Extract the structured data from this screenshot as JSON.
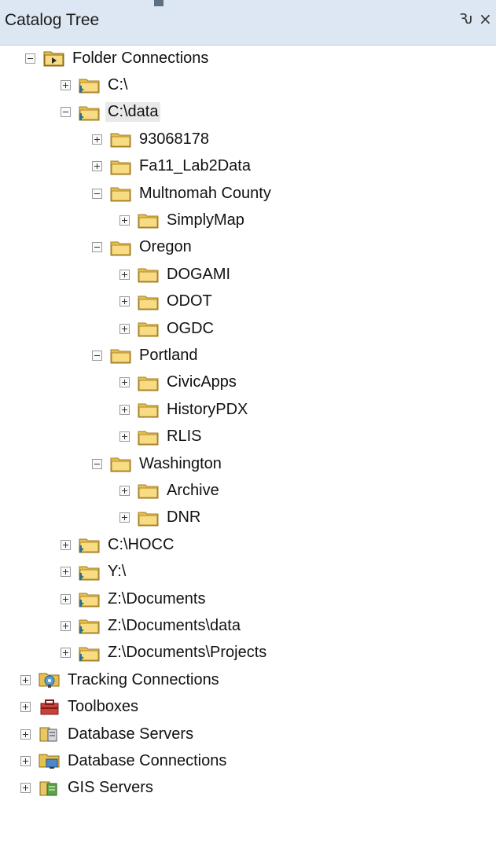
{
  "panel": {
    "title": "Catalog Tree",
    "pin_glyph": "Ԅ",
    "close_glyph": "×"
  },
  "tree": [
    {
      "label": "Folder Connections",
      "expanded": true,
      "icon": "folder-connections-icon"
    },
    {
      "label": "C:\\",
      "expanded": false,
      "icon": "folder-connection-icon"
    },
    {
      "label": "C:\\data",
      "expanded": true,
      "icon": "folder-connection-icon",
      "selected": true
    },
    {
      "label": "93068178",
      "expanded": false,
      "icon": "folder-icon"
    },
    {
      "label": "Fa11_Lab2Data",
      "expanded": false,
      "icon": "folder-icon"
    },
    {
      "label": "Multnomah County",
      "expanded": true,
      "icon": "folder-icon"
    },
    {
      "label": "SimplyMap",
      "expanded": false,
      "icon": "folder-icon"
    },
    {
      "label": "Oregon",
      "expanded": true,
      "icon": "folder-icon"
    },
    {
      "label": "DOGAMI",
      "expanded": false,
      "icon": "folder-icon"
    },
    {
      "label": "ODOT",
      "expanded": false,
      "icon": "folder-icon"
    },
    {
      "label": "OGDC",
      "expanded": false,
      "icon": "folder-icon"
    },
    {
      "label": "Portland",
      "expanded": true,
      "icon": "folder-icon"
    },
    {
      "label": "CivicApps",
      "expanded": false,
      "icon": "folder-icon"
    },
    {
      "label": "HistoryPDX",
      "expanded": false,
      "icon": "folder-icon"
    },
    {
      "label": "RLIS",
      "expanded": false,
      "icon": "folder-icon"
    },
    {
      "label": "Washington",
      "expanded": true,
      "icon": "folder-icon"
    },
    {
      "label": "Archive",
      "expanded": false,
      "icon": "folder-icon"
    },
    {
      "label": "DNR",
      "expanded": false,
      "icon": "folder-icon"
    },
    {
      "label": "C:\\HOCC",
      "expanded": false,
      "icon": "folder-connection-icon"
    },
    {
      "label": "Y:\\",
      "expanded": false,
      "icon": "folder-connection-icon"
    },
    {
      "label": "Z:\\Documents",
      "expanded": false,
      "icon": "folder-connection-icon"
    },
    {
      "label": "Z:\\Documents\\data",
      "expanded": false,
      "icon": "folder-connection-icon"
    },
    {
      "label": "Z:\\Documents\\Projects",
      "expanded": false,
      "icon": "folder-connection-icon"
    },
    {
      "label": "Tracking Connections",
      "expanded": false,
      "icon": "tracking-connections-icon"
    },
    {
      "label": "Toolboxes",
      "expanded": false,
      "icon": "toolboxes-icon"
    },
    {
      "label": "Database Servers",
      "expanded": false,
      "icon": "database-servers-icon"
    },
    {
      "label": "Database Connections",
      "expanded": false,
      "icon": "database-connections-icon"
    },
    {
      "label": "GIS Servers",
      "expanded": false,
      "icon": "gis-servers-icon"
    }
  ]
}
